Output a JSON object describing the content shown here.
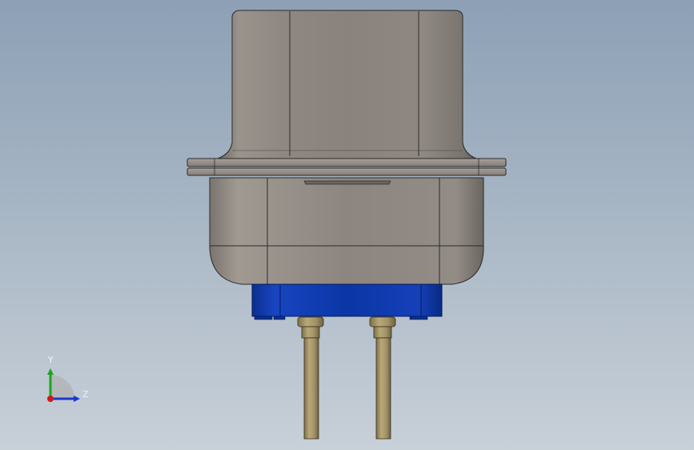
{
  "viewport": {
    "background_top": "#8da0b6",
    "background_bottom": "#c8d0d8"
  },
  "model": {
    "body_color": "#8b847e",
    "connector_color": "#0a3aa8",
    "pin_color": "#a89868",
    "edge_color": "#2a2a2a"
  },
  "triad": {
    "y_label": "Y",
    "z_label": "Z",
    "y_color": "#1aa61a",
    "z_color": "#1a3acc",
    "x_color": "#cc1a1a"
  }
}
